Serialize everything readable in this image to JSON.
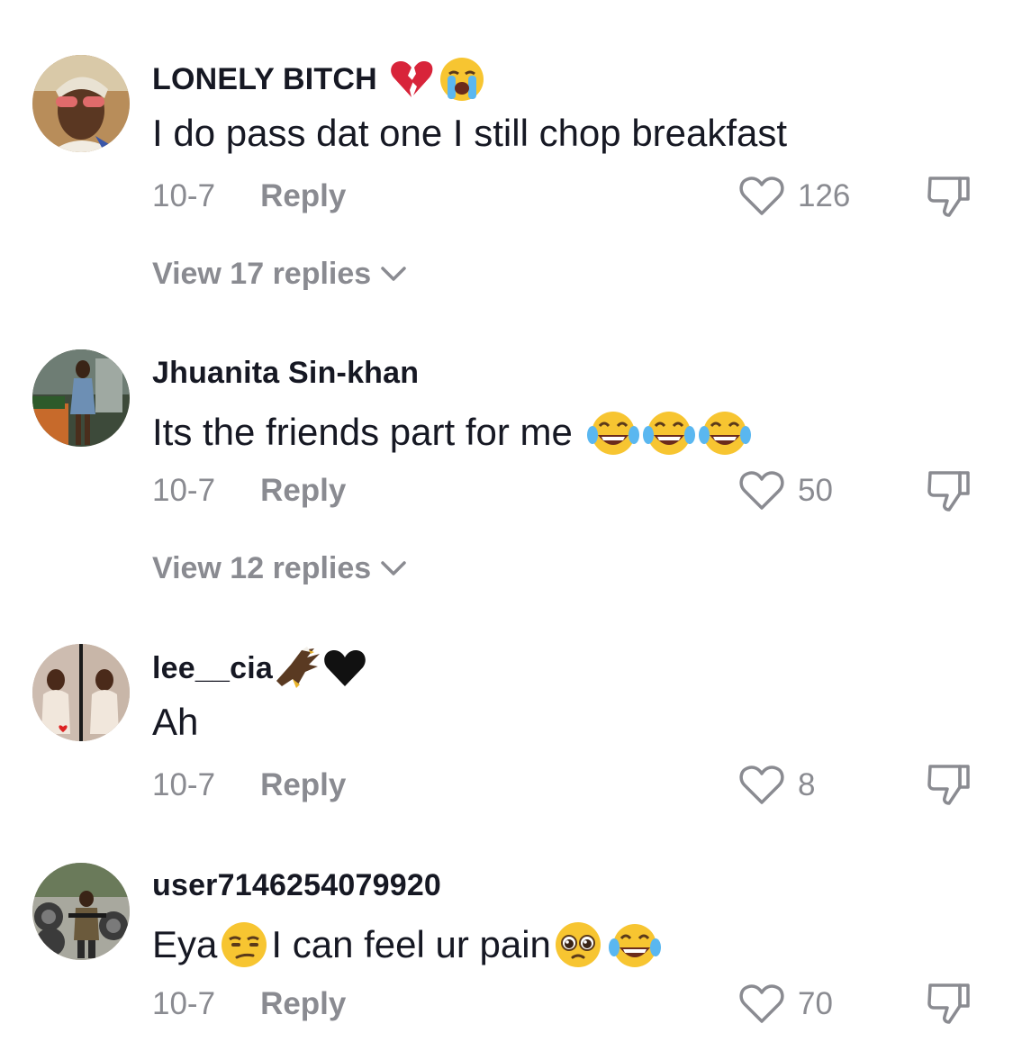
{
  "comments": [
    {
      "username": "LONELY BITCH",
      "username_emojis": [
        "broken-heart-emoji",
        "loudly-crying-face-emoji"
      ],
      "text": "I do pass dat one I still chop breakfast",
      "date": "10-7",
      "reply_label": "Reply",
      "likes": "126",
      "view_replies": "View 17 replies"
    },
    {
      "username": "Jhuanita Sin-khan",
      "text": "Its the friends part for me",
      "text_emojis": [
        "face-with-tears-of-joy-emoji",
        "face-with-tears-of-joy-emoji",
        "face-with-tears-of-joy-emoji"
      ],
      "date": "10-7",
      "reply_label": "Reply",
      "likes": "50",
      "view_replies": "View 12 replies"
    },
    {
      "username": "lee__cia",
      "username_emojis": [
        "eagle-emoji",
        "black-heart-emoji"
      ],
      "text": "Ah",
      "date": "10-7",
      "reply_label": "Reply",
      "likes": "8"
    },
    {
      "username": "user7146254079920",
      "text_parts": [
        "Eya",
        "I can feel ur pain"
      ],
      "text_emojis": [
        "unamused-face-emoji",
        "pleading-face-emoji",
        "face-with-tears-of-joy-emoji"
      ],
      "date": "10-7",
      "reply_label": "Reply",
      "likes": "70"
    }
  ],
  "icons": {
    "like": "heart-outline-icon",
    "dislike": "thumbs-down-outline-icon",
    "expand": "chevron-down-icon"
  },
  "colors": {
    "text_primary": "#161823",
    "text_secondary": "#8a8b91",
    "background": "#ffffff"
  }
}
